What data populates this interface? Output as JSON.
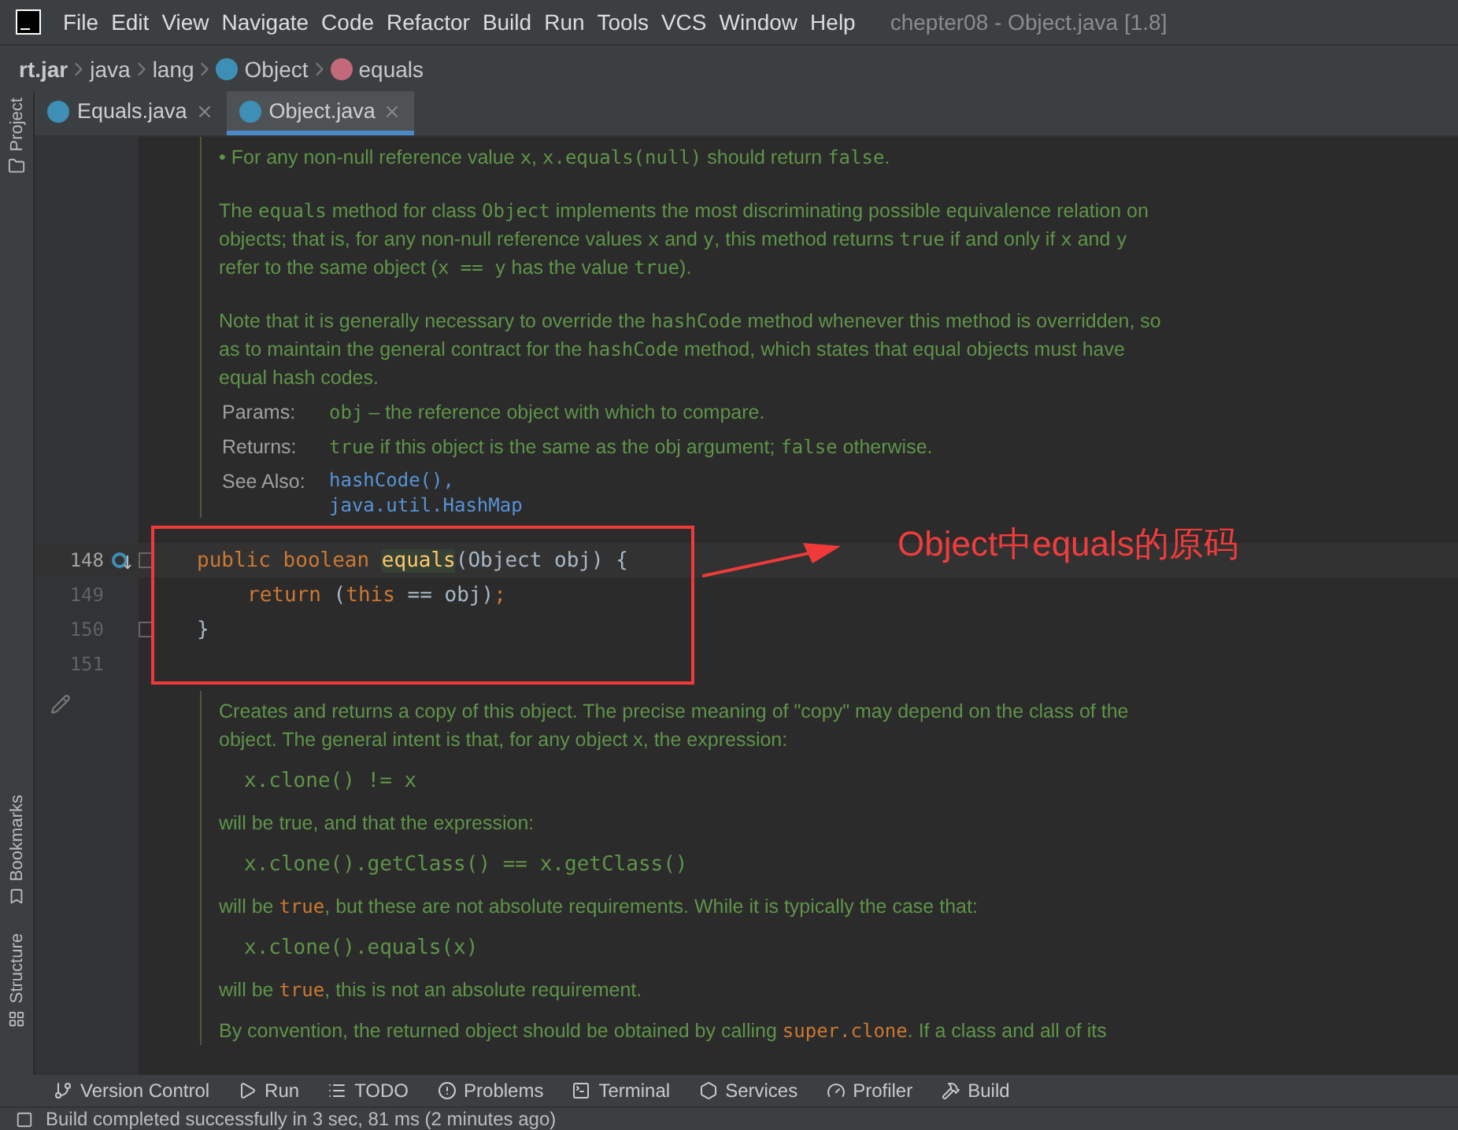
{
  "menu": [
    "File",
    "Edit",
    "View",
    "Navigate",
    "Code",
    "Refactor",
    "Build",
    "Run",
    "Tools",
    "VCS",
    "Window",
    "Help"
  ],
  "window": {
    "title": "chepter08 - Object.java [1.8]"
  },
  "breadcrumb": [
    {
      "label": "rt.jar",
      "kind": "root"
    },
    {
      "label": "java",
      "kind": "package"
    },
    {
      "label": "lang",
      "kind": "package"
    },
    {
      "label": "Object",
      "kind": "class"
    },
    {
      "label": "equals",
      "kind": "method"
    }
  ],
  "tabs": [
    {
      "label": "Equals.java",
      "selected": false
    },
    {
      "label": "Object.java",
      "selected": true
    }
  ],
  "side_tools": {
    "top": [
      "Project"
    ],
    "bottom": [
      "Bookmarks",
      "Structure"
    ]
  },
  "doc_top": [
    {
      "kind": "bullet",
      "marker": "•",
      "segments": [
        {
          "t": "For any non-null reference value ",
          "code": false
        },
        {
          "t": "x",
          "code": true
        },
        {
          "t": ", ",
          "code": false
        },
        {
          "t": "x.equals(null)",
          "code": true
        },
        {
          "t": " should return ",
          "code": false
        },
        {
          "t": "false",
          "code": true
        },
        {
          "t": ".",
          "code": false
        }
      ]
    },
    {
      "kind": "para",
      "segments": [
        {
          "t": "The ",
          "code": false
        },
        {
          "t": "equals",
          "code": true
        },
        {
          "t": " method for class ",
          "code": false
        },
        {
          "t": "Object",
          "code": true
        },
        {
          "t": " implements the most discriminating possible equivalence relation on objects; that is, for any non-null reference values ",
          "code": false
        },
        {
          "t": "x",
          "code": true
        },
        {
          "t": " and ",
          "code": false
        },
        {
          "t": "y",
          "code": true
        },
        {
          "t": ", this method returns ",
          "code": false
        },
        {
          "t": "true",
          "code": true
        },
        {
          "t": " if and only if ",
          "code": false
        },
        {
          "t": "x",
          "code": true
        },
        {
          "t": " and ",
          "code": false
        },
        {
          "t": "y",
          "code": true
        },
        {
          "t": " refer to the same object (",
          "code": false
        },
        {
          "t": "x == y",
          "code": true
        },
        {
          "t": " has the value ",
          "code": false
        },
        {
          "t": "true",
          "code": true
        },
        {
          "t": ").",
          "code": false
        }
      ]
    },
    {
      "kind": "para",
      "segments": [
        {
          "t": "Note that it is generally necessary to override the ",
          "code": false
        },
        {
          "t": "hashCode",
          "code": true
        },
        {
          "t": " method whenever this method is overridden, so as to maintain the general contract for the ",
          "code": false
        },
        {
          "t": "hashCode",
          "code": true
        },
        {
          "t": " method, which states that equal objects must have equal hash codes.",
          "code": false
        }
      ]
    },
    {
      "kind": "tag",
      "label": "Params:",
      "segments": [
        {
          "t": "obj",
          "code": true
        },
        {
          "t": " – the reference object with which to compare.",
          "code": false
        }
      ]
    },
    {
      "kind": "tag",
      "label": "Returns:",
      "segments": [
        {
          "t": "true",
          "code": true
        },
        {
          "t": " if this object is the same as the obj argument; ",
          "code": false
        },
        {
          "t": "false",
          "code": true
        },
        {
          "t": " otherwise.",
          "code": false
        }
      ]
    },
    {
      "kind": "links",
      "label": "See Also:",
      "links": [
        "hashCode(),",
        "java.util.HashMap"
      ]
    }
  ],
  "code_lines": [
    {
      "number": "148",
      "current": true,
      "indented": false,
      "tokens": [
        {
          "t": "public ",
          "kind": "keyword"
        },
        {
          "t": "boolean ",
          "kind": "keyword"
        },
        {
          "t": "equals",
          "kind": "method"
        },
        {
          "t": "(Object obj) {",
          "kind": "plain"
        }
      ]
    },
    {
      "number": "149",
      "current": false,
      "indented": true,
      "tokens": [
        {
          "t": "return ",
          "kind": "keyword"
        },
        {
          "t": "(",
          "kind": "plain"
        },
        {
          "t": "this",
          "kind": "keyword"
        },
        {
          "t": " == obj)",
          "kind": "plain"
        },
        {
          "t": ";",
          "kind": "keyword"
        }
      ]
    },
    {
      "number": "150",
      "current": false,
      "indented": false,
      "tokens": [
        {
          "t": "}",
          "kind": "plain"
        }
      ]
    },
    {
      "number": "151",
      "current": false
    }
  ],
  "annotation": {
    "text": "Object中equals的原码"
  },
  "doc_bottom": [
    {
      "kind": "para",
      "segments": [
        {
          "t": "Creates and returns a copy of this object. The precise meaning of \"copy\" may depend on the class of the object. The general intent is that, for any object ",
          "code": false
        },
        {
          "t": "x",
          "code": false
        },
        {
          "t": ", the expression:",
          "code": false
        }
      ]
    },
    {
      "kind": "sample",
      "text": "x.clone() != x"
    },
    {
      "kind": "para",
      "segments": [
        {
          "t": "will be true, and that the expression:",
          "code": false
        }
      ]
    },
    {
      "kind": "sample",
      "text": "x.clone().getClass() == x.getClass()"
    },
    {
      "kind": "para",
      "segments": [
        {
          "t": "will be ",
          "code": false
        },
        {
          "t": "true",
          "code": true
        },
        {
          "t": ", but these are not absolute requirements. While it is typically the case that:",
          "code": false
        }
      ]
    },
    {
      "kind": "sample",
      "text": "x.clone().equals(x)"
    },
    {
      "kind": "para",
      "segments": [
        {
          "t": "will be ",
          "code": false
        },
        {
          "t": "true",
          "code": true
        },
        {
          "t": ", this is not an absolute requirement.",
          "code": false
        }
      ]
    },
    {
      "kind": "para",
      "segments": [
        {
          "t": "By convention, the returned object should be obtained by calling ",
          "code": false
        },
        {
          "t": "super.clone",
          "code": true
        },
        {
          "t": ". If a class and all of its",
          "code": false
        }
      ]
    }
  ],
  "tool_windows": [
    {
      "label": "Version Control"
    },
    {
      "label": "Run"
    },
    {
      "label": "TODO"
    },
    {
      "label": "Problems"
    },
    {
      "label": "Terminal"
    },
    {
      "label": "Services"
    },
    {
      "label": "Profiler"
    },
    {
      "label": "Build"
    }
  ],
  "status_bar": {
    "text": "Build completed successfully in 3 sec, 81 ms (2 minutes ago)"
  }
}
